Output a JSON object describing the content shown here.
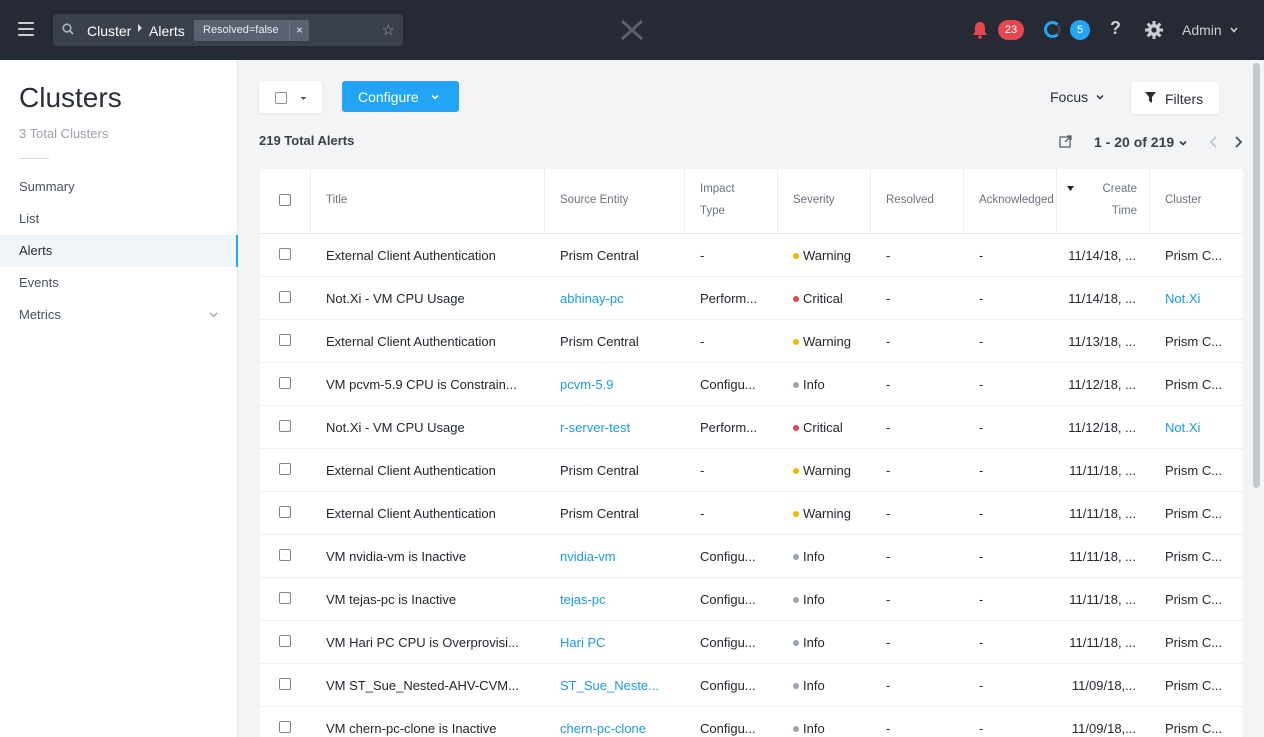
{
  "topbar": {
    "breadcrumb": [
      "Cluster",
      "Alerts"
    ],
    "filter_chip": "Resolved=false",
    "filter_chip_close": "×",
    "star": "☆",
    "alerts_count": "23",
    "tasks_count": "5",
    "help": "?",
    "user": "Admin"
  },
  "sidebar": {
    "title": "Clusters",
    "subtitle": "3 Total Clusters",
    "items": [
      {
        "label": "Summary"
      },
      {
        "label": "List"
      },
      {
        "label": "Alerts"
      },
      {
        "label": "Events"
      },
      {
        "label": "Metrics"
      }
    ]
  },
  "toolbar": {
    "configure_label": "Configure",
    "focus_label": "Focus",
    "filters_label": "Filters",
    "total_label": "219 Total Alerts",
    "page_range": "1 - 20 of 219"
  },
  "table": {
    "headers": {
      "title": "Title",
      "source": "Source Entity",
      "impact_1": "Impact",
      "impact_2": "Type",
      "severity": "Severity",
      "resolved": "Resolved",
      "acknowledged": "Acknowledged",
      "create_1": "Create",
      "create_2": "Time",
      "cluster": "Cluster"
    },
    "rows": [
      {
        "title": "External Client Authentication",
        "source": "Prism Central",
        "impact": "-",
        "severity": "Warning",
        "resolved": "-",
        "ack": "-",
        "time": "11/14/18, ...",
        "cluster": "Prism C..."
      },
      {
        "title": "Not.Xi - VM CPU Usage",
        "source": "abhinay-pc",
        "impact": "Perform...",
        "severity": "Critical",
        "resolved": "-",
        "ack": "-",
        "time": "11/14/18, ...",
        "cluster": "Not.Xi"
      },
      {
        "title": "External Client Authentication",
        "source": "Prism Central",
        "impact": "-",
        "severity": "Warning",
        "resolved": "-",
        "ack": "-",
        "time": "11/13/18, ...",
        "cluster": "Prism C..."
      },
      {
        "title": "VM pcvm-5.9 CPU is Constrain...",
        "source": "pcvm-5.9",
        "impact": "Configu...",
        "severity": "Info",
        "resolved": "-",
        "ack": "-",
        "time": "11/12/18, ...",
        "cluster": "Prism C..."
      },
      {
        "title": "Not.Xi - VM CPU Usage",
        "source": "r-server-test",
        "impact": "Perform...",
        "severity": "Critical",
        "resolved": "-",
        "ack": "-",
        "time": "11/12/18, ...",
        "cluster": "Not.Xi"
      },
      {
        "title": "External Client Authentication",
        "source": "Prism Central",
        "impact": "-",
        "severity": "Warning",
        "resolved": "-",
        "ack": "-",
        "time": "11/11/18, ...",
        "cluster": "Prism C..."
      },
      {
        "title": "External Client Authentication",
        "source": "Prism Central",
        "impact": "-",
        "severity": "Warning",
        "resolved": "-",
        "ack": "-",
        "time": "11/11/18, ...",
        "cluster": "Prism C..."
      },
      {
        "title": "VM nvidia-vm is Inactive",
        "source": "nvidia-vm",
        "impact": "Configu...",
        "severity": "Info",
        "resolved": "-",
        "ack": "-",
        "time": "11/11/18, ...",
        "cluster": "Prism C..."
      },
      {
        "title": "VM tejas-pc is Inactive",
        "source": "tejas-pc",
        "impact": "Configu...",
        "severity": "Info",
        "resolved": "-",
        "ack": "-",
        "time": "11/11/18, ...",
        "cluster": "Prism C..."
      },
      {
        "title": "VM Hari PC CPU is Overprovisi...",
        "source": "Hari PC",
        "impact": "Configu...",
        "severity": "Info",
        "resolved": "-",
        "ack": "-",
        "time": "11/11/18, ...",
        "cluster": "Prism C..."
      },
      {
        "title": "VM ST_Sue_Nested-AHV-CVM...",
        "source": "ST_Sue_Neste...",
        "impact": "Configu...",
        "severity": "Info",
        "resolved": "-",
        "ack": "-",
        "time": "11/09/18,...",
        "cluster": "Prism C..."
      },
      {
        "title": "VM chern-pc-clone is Inactive",
        "source": "chern-pc-clone",
        "impact": "Configu...",
        "severity": "Info",
        "resolved": "-",
        "ack": "-",
        "time": "11/09/18,...",
        "cluster": "Prism C..."
      }
    ]
  },
  "colors": {
    "accent": "#22a5f7",
    "link": "#1b9ae6",
    "warning": "#f5b800",
    "critical": "#e6474e",
    "info": "#9aa3b0",
    "topbar": "#252a35"
  }
}
